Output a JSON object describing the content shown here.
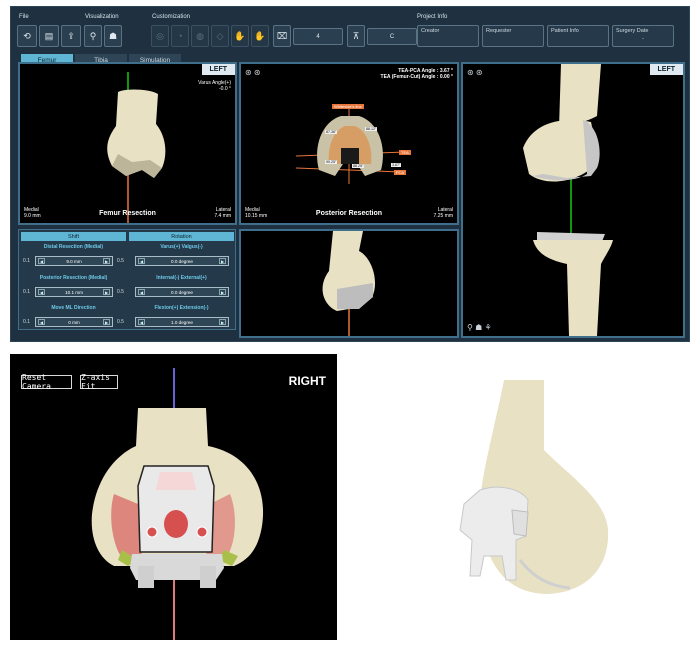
{
  "menu": {
    "file": "File",
    "visualization": "Visualization",
    "customization": "Customization",
    "project_info": "Project Info"
  },
  "toolbar": {
    "spin1_value": "4",
    "spin2_value": "C"
  },
  "project_info": {
    "fields": [
      {
        "label": "Creator",
        "value": ""
      },
      {
        "label": "Requester",
        "value": ""
      },
      {
        "label": "Patient Info",
        "value": ""
      },
      {
        "label": "Surgery Date",
        "value": "-"
      }
    ]
  },
  "tabs": [
    "Femur",
    "Tibia",
    "Simulation"
  ],
  "views": {
    "femur": {
      "badge": "LEFT",
      "angle_label": "Varus Angle(+)",
      "angle_value": "-0.0 °",
      "title": "Femur Resection",
      "medial_label": "Medial",
      "medial_value": "9.0 mm",
      "lateral_label": "Lateral",
      "lateral_value": "7.4 mm"
    },
    "posterior": {
      "tea_pca": "TEA-PCA Angle : 3.67 °",
      "tea_femur": "TEA (Femur-Cut) Angle : 0.00 °",
      "title": "Posterior Resection",
      "medial_label": "Medial",
      "medial_value": "10.15 mm",
      "lateral_label": "Lateral",
      "lateral_value": "7.25 mm",
      "annotations": {
        "whiteside": "Whiteside's line",
        "tea": "TEA",
        "pca": "PCA",
        "a1": "87.36°",
        "a2": "88.12°",
        "a3": "90.25°",
        "a4": "88.25°",
        "a5": "3.67°"
      }
    },
    "right": {
      "badge": "LEFT"
    }
  },
  "controls": {
    "shift_header": "Shift",
    "rotation_header": "Rotation",
    "rows": [
      {
        "label": "Distal Resection (Medial)",
        "value": "9.0 mm",
        "min": "0.1",
        "max": "0.5"
      },
      {
        "label": "Posterior Resection (Medial)",
        "value": "10.1 mm",
        "min": "0.1",
        "max": "0.5"
      },
      {
        "label": "Move ML Direction",
        "value": "0 mm",
        "min": "0.1",
        "max": "0.5"
      }
    ],
    "rot_rows": [
      {
        "label": "Varus(+) Valgus(-)",
        "value": "0.0 degree"
      },
      {
        "label": "Internal(-) External(+)",
        "value": "0.0 degree"
      },
      {
        "label": "Flexion(+) Extension(-)",
        "value": "1.0 degree"
      }
    ]
  },
  "render3d": {
    "reset_camera": "Reset Camera",
    "z_axis_fit": "Z-axis Fit",
    "side": "RIGHT"
  },
  "colors": {
    "bone": "#e8e1c4",
    "accent": "#5fb6d4",
    "badge": "#dfe9ef",
    "resection": "#e8763a",
    "panel": "#1f3140"
  }
}
